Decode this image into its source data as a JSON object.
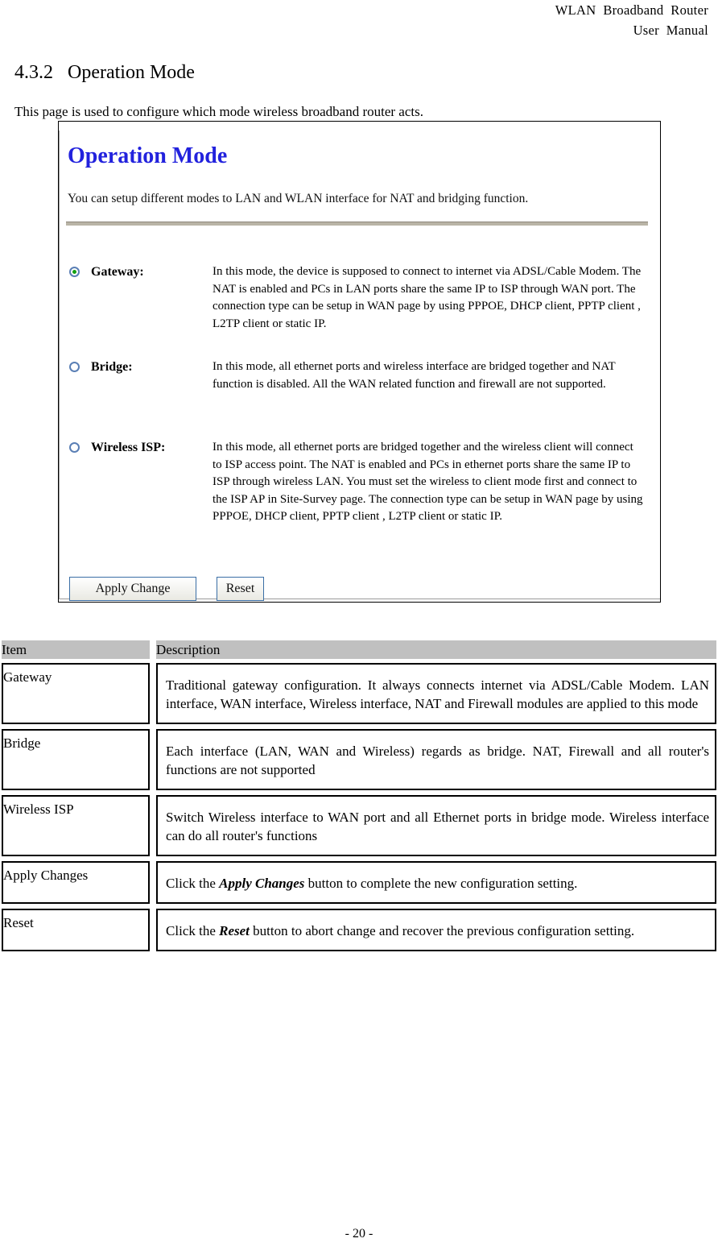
{
  "header": {
    "line1": "WLAN  Broadband  Router",
    "line2": "User  Manual"
  },
  "section": {
    "number": "4.3.2",
    "title": "Operation Mode",
    "heading": "4.3.2   Operation Mode",
    "intro": "This page is used to configure which mode wireless broadband router acts."
  },
  "screenshot": {
    "title": "Operation Mode",
    "subtitle": "You can setup different modes to LAN and WLAN interface for NAT and bridging function.",
    "modes": [
      {
        "label": "Gateway:",
        "selected": true,
        "description": "In this mode, the device is supposed to connect to internet via ADSL/Cable Modem. The NAT is enabled and PCs in LAN ports share the same IP to ISP through WAN port. The connection type can be setup in WAN page by using PPPOE, DHCP client, PPTP client , L2TP client or static IP."
      },
      {
        "label": "Bridge:",
        "selected": false,
        "description": "In this mode, all ethernet ports and wireless interface are bridged together and NAT function is disabled. All the WAN related function and firewall are not supported."
      },
      {
        "label": "Wireless ISP:",
        "selected": false,
        "description": "In this mode, all ethernet ports are bridged together and the wireless client will connect to ISP access point. The NAT is enabled and PCs in ethernet ports share the same IP to ISP through wireless LAN. You must set the wireless to client mode first and connect to the ISP AP in Site-Survey page. The connection type can be setup in WAN page by using PPPOE, DHCP client, PPTP client , L2TP client or static IP."
      }
    ],
    "buttons": {
      "apply": "Apply Change",
      "reset": "Reset"
    },
    "colors": {
      "title": "#2222dd",
      "radio_border": "#5a7fb5",
      "radio_dot": "#12a012",
      "rule": "#b9b4a6",
      "button_border": "#3a6ea5"
    }
  },
  "table": {
    "headers": {
      "item": "Item",
      "description": "Description"
    },
    "header_bg": "#c0c0c0",
    "rows": [
      {
        "item": "Gateway",
        "desc_pre": "Traditional gateway configuration. It always connects internet via ADSL/Cable Modem. LAN interface, WAN interface, Wireless interface, NAT and Firewall modules are applied to this mode",
        "desc_em": "",
        "desc_post": ""
      },
      {
        "item": "Bridge",
        "desc_pre": "Each interface (LAN, WAN and Wireless) regards as bridge. NAT, Firewall and all router's functions are not supported",
        "desc_em": "",
        "desc_post": ""
      },
      {
        "item": "Wireless ISP",
        "desc_pre": "Switch Wireless interface to WAN port and all Ethernet ports in bridge mode. Wireless interface can do all router's functions",
        "desc_em": "",
        "desc_post": ""
      },
      {
        "item": "Apply Changes",
        "desc_pre": "Click the ",
        "desc_em": "Apply Changes",
        "desc_post": " button to complete the new configuration setting."
      },
      {
        "item": "Reset",
        "desc_pre": "Click the ",
        "desc_em": "Reset",
        "desc_post": " button to abort change and recover the previous configuration setting."
      }
    ]
  },
  "footer": {
    "page_number": "- 20 -"
  }
}
